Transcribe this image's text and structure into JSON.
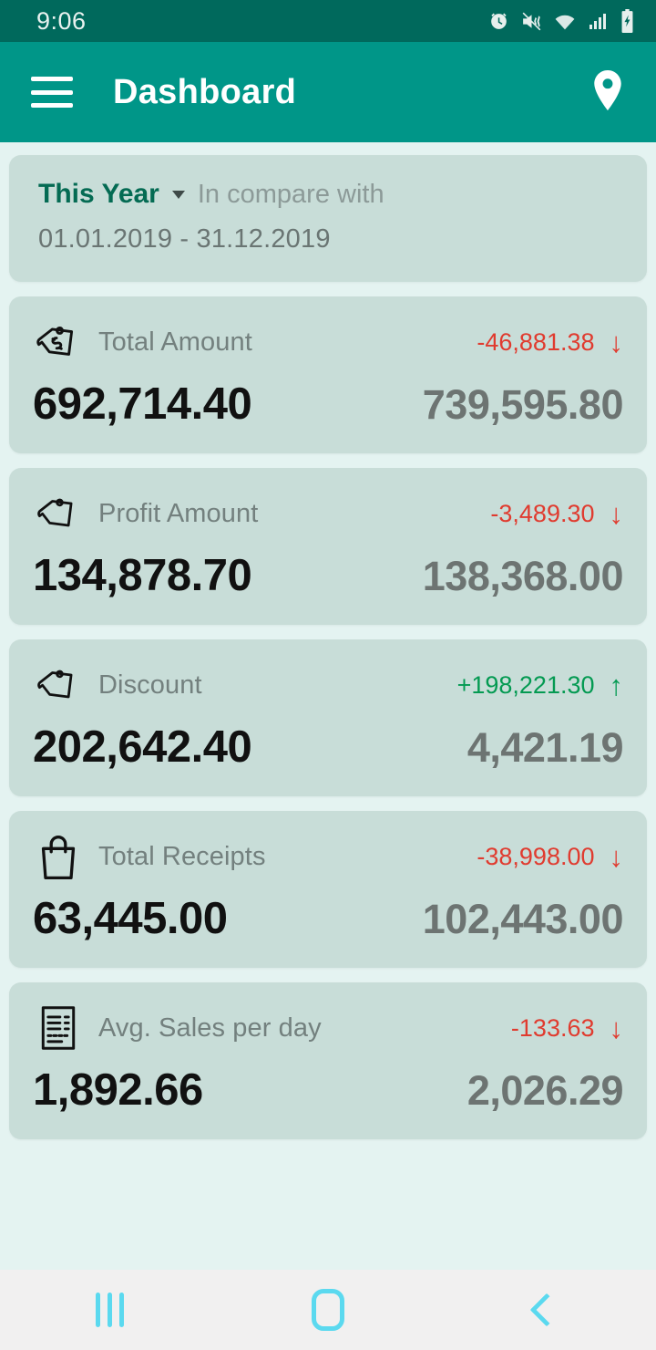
{
  "status_bar": {
    "clock": "9:06",
    "icons": [
      "alarm-icon",
      "mute-vibrate-icon",
      "wifi-icon",
      "cellular-signal-icon",
      "battery-charging-icon"
    ]
  },
  "app_bar": {
    "menu_icon": "hamburger-menu-icon",
    "title": "Dashboard",
    "action_icon": "location-pin-icon"
  },
  "period": {
    "label": "This Year",
    "caret_icon": "chevron-down-icon",
    "compare_label": "In compare with",
    "range": "01.01.2019 - 31.12.2019"
  },
  "metrics": [
    {
      "icon": "price-tag-currency-icon",
      "title": "Total Amount",
      "value": "692,714.40",
      "delta": "-46,881.38",
      "direction": "down",
      "arrow": "↓",
      "compare_value": "739,595.80"
    },
    {
      "icon": "price-tag-icon",
      "title": "Profit Amount",
      "value": "134,878.70",
      "delta": "-3,489.30",
      "direction": "down",
      "arrow": "↓",
      "compare_value": "138,368.00"
    },
    {
      "icon": "price-tag-icon",
      "title": "Discount",
      "value": "202,642.40",
      "delta": "+198,221.30",
      "direction": "up",
      "arrow": "↑",
      "compare_value": "4,421.19"
    },
    {
      "icon": "shopping-bag-icon",
      "title": "Total Receipts",
      "value": "63,445.00",
      "delta": "-38,998.00",
      "direction": "down",
      "arrow": "↓",
      "compare_value": "102,443.00"
    },
    {
      "icon": "receipt-icon",
      "title": "Avg. Sales per day",
      "value": "1,892.66",
      "delta": "-133.63",
      "direction": "down",
      "arrow": "↓",
      "compare_value": "2,026.29"
    }
  ],
  "nav_bar": {
    "recents_icon": "recents-icon",
    "home_icon": "home-icon",
    "back_icon": "back-icon"
  },
  "colors": {
    "status_bar": "#00695c",
    "app_bar": "#009688",
    "page_background": "#e4f3f1",
    "card_background": "#c8ddd8",
    "accent_teal": "#046b53",
    "negative_red": "#e03b2f",
    "positive_green": "#049a52",
    "nav_icon_cyan": "#5bd9ef"
  }
}
